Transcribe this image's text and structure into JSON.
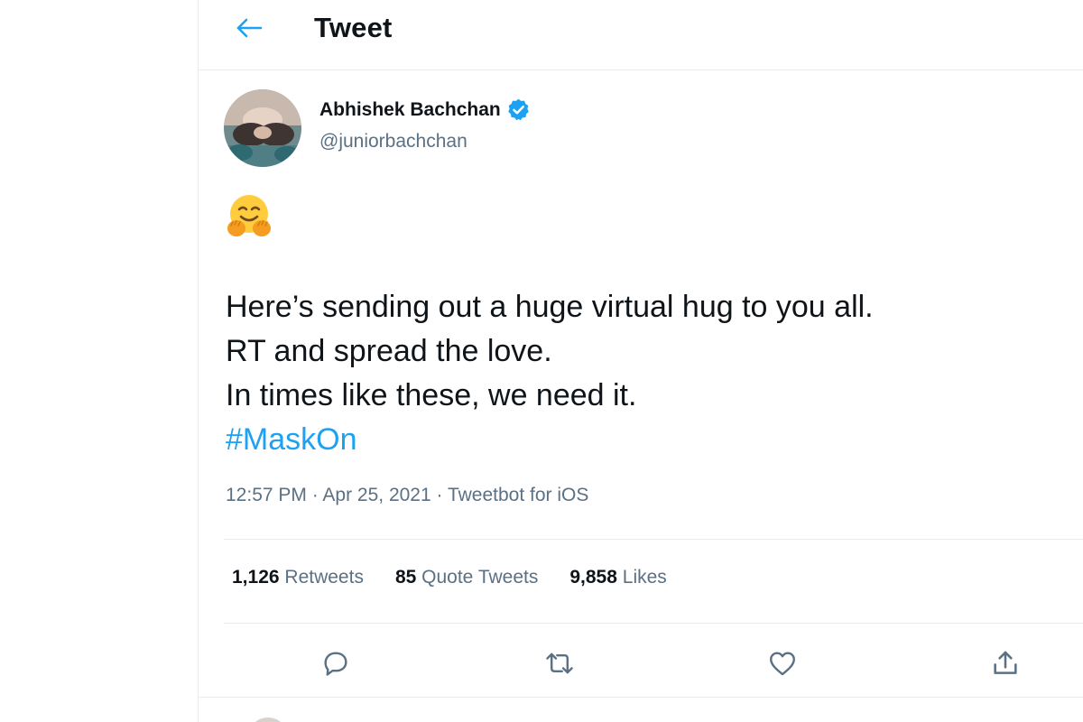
{
  "header": {
    "title": "Tweet",
    "back_icon": "arrow-left-icon"
  },
  "colors": {
    "accent": "#1da1f2",
    "text": "#0f1419",
    "muted": "#5b7083",
    "border": "#e6ecf0"
  },
  "tweet": {
    "author": {
      "name": "Abhishek Bachchan",
      "handle": "@juniorbachchan",
      "verified": true
    },
    "emoji": "🤗",
    "text_lines": [
      "Here’s sending out a huge virtual hug to you all.",
      "RT and spread the love.",
      "In times like these, we need it."
    ],
    "hashtag": "#MaskOn",
    "time": "12:57 PM",
    "separator": " · ",
    "date": "Apr 25, 2021",
    "source": "Tweetbot for iOS"
  },
  "stats": {
    "retweets": {
      "count": "1,126",
      "label": "Retweets"
    },
    "quote_tweets": {
      "count": "85",
      "label": "Quote Tweets"
    },
    "likes": {
      "count": "9,858",
      "label": "Likes"
    }
  },
  "actions": [
    {
      "name": "reply",
      "icon": "reply-icon"
    },
    {
      "name": "retweet",
      "icon": "retweet-icon"
    },
    {
      "name": "like",
      "icon": "heart-icon"
    },
    {
      "name": "share",
      "icon": "share-icon"
    }
  ]
}
